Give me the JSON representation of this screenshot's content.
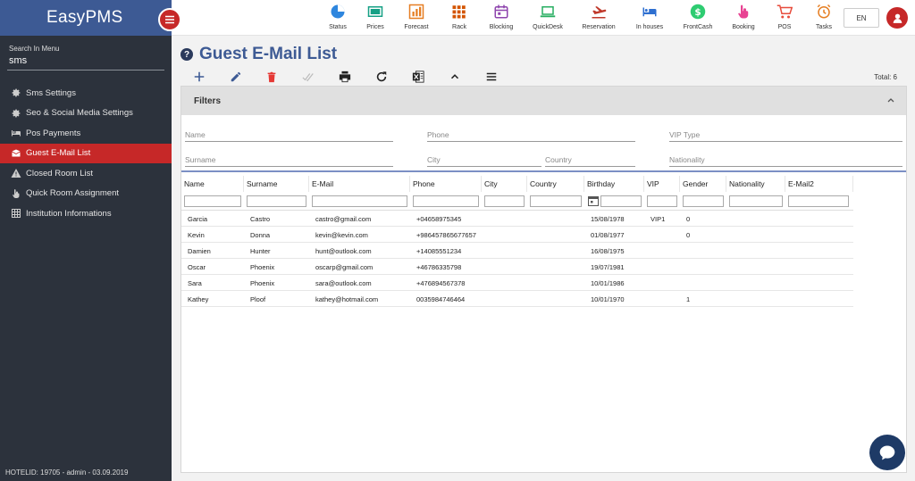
{
  "app": {
    "name": "EasyPMS"
  },
  "sidebar": {
    "search_label": "Search In Menu",
    "search_value": "sms",
    "items": [
      {
        "label": "Sms Settings",
        "icon": "gear-icon",
        "active": false
      },
      {
        "label": "Seo & Social Media Settings",
        "icon": "gear-icon",
        "active": false
      },
      {
        "label": "Pos Payments",
        "icon": "bed-icon",
        "active": false
      },
      {
        "label": "Guest E-Mail List",
        "icon": "mail-icon",
        "active": true
      },
      {
        "label": "Closed Room List",
        "icon": "warning-icon",
        "active": false
      },
      {
        "label": "Quick Room Assignment",
        "icon": "hand-icon",
        "active": false
      },
      {
        "label": "Institution Informations",
        "icon": "grid-icon",
        "active": false
      }
    ],
    "footer": "HOTELID: 19705 - admin - 03.09.2019"
  },
  "topnav": {
    "items": [
      {
        "label": "Status",
        "icon": "pie-chart-icon",
        "color": "#2e86de"
      },
      {
        "label": "Prices",
        "icon": "price-board-icon",
        "color": "#16a085"
      },
      {
        "label": "Forecast",
        "icon": "bar-chart-icon",
        "color": "#e67e22"
      },
      {
        "label": "Rack",
        "icon": "rack-grid-icon",
        "color": "#d35400"
      },
      {
        "label": "Blocking",
        "icon": "calendar-icon",
        "color": "#8e44ad"
      },
      {
        "label": "QuickDesk",
        "icon": "laptop-icon",
        "color": "#27ae60"
      },
      {
        "label": "Reservation",
        "icon": "plane-icon",
        "color": "#c0392b"
      },
      {
        "label": "In houses",
        "icon": "bed-icon",
        "color": "#2e6fd0"
      },
      {
        "label": "FrontCash",
        "icon": "dollar-icon",
        "color": "#2ecc71"
      },
      {
        "label": "Booking",
        "icon": "touch-icon",
        "color": "#e84393"
      },
      {
        "label": "POS",
        "icon": "cart-icon",
        "color": "#e74c3c"
      },
      {
        "label": "Tasks",
        "icon": "alarm-icon",
        "color": "#e67e22"
      }
    ],
    "language": "EN"
  },
  "page": {
    "title": "Guest E-Mail List",
    "total": "Total: 6"
  },
  "toolbar": {
    "buttons": [
      "add-icon",
      "edit-icon",
      "delete-icon",
      "check-icon",
      "print-icon",
      "refresh-icon",
      "excel-icon",
      "collapse-icon",
      "menu-icon"
    ]
  },
  "filters": {
    "title": "Filters",
    "fields": {
      "name": "Name",
      "phone": "Phone",
      "vip_type": "VIP Type",
      "surname": "Surname",
      "city": "City",
      "country": "Country",
      "nationality": "Nationality"
    }
  },
  "grid": {
    "columns": [
      "Name",
      "Surname",
      "E-Mail",
      "Phone",
      "City",
      "Country",
      "Birthday",
      "VIP",
      "Gender",
      "Nationality",
      "E-Mail2"
    ],
    "rows": [
      [
        "Garcia",
        "Castro",
        "castro@gmail.com",
        "+04658975345",
        "",
        "",
        "15/08/1978",
        "VIP1",
        "0",
        "",
        ""
      ],
      [
        "Kevin",
        "Donna",
        "kevin@kevin.com",
        "+986457865677657",
        "",
        "",
        "01/08/1977",
        "",
        "0",
        "",
        ""
      ],
      [
        "Damien",
        "Hunter",
        "hunt@outlook.com",
        "+14085551234",
        "",
        "",
        "16/08/1975",
        "",
        "",
        "",
        ""
      ],
      [
        "Oscar",
        "Phoenix",
        "oscarp@gmail.com",
        "+46786335798",
        "",
        "",
        "19/07/1981",
        "",
        "",
        "",
        ""
      ],
      [
        "Sara",
        "Phoenix",
        "sara@outlook.com",
        "+476894567378",
        "",
        "",
        "10/01/1986",
        "",
        "",
        "",
        ""
      ],
      [
        "Kathey",
        "Ploof",
        "kathey@hotmail.com",
        "0035984746464",
        "",
        "",
        "10/01/1970",
        "",
        "1",
        "",
        ""
      ]
    ]
  },
  "colors": {
    "sidebar_bg": "#2c323c",
    "brand_bg": "#3d5a94",
    "accent_red": "#c62828",
    "title_blue": "#3d5a94"
  }
}
